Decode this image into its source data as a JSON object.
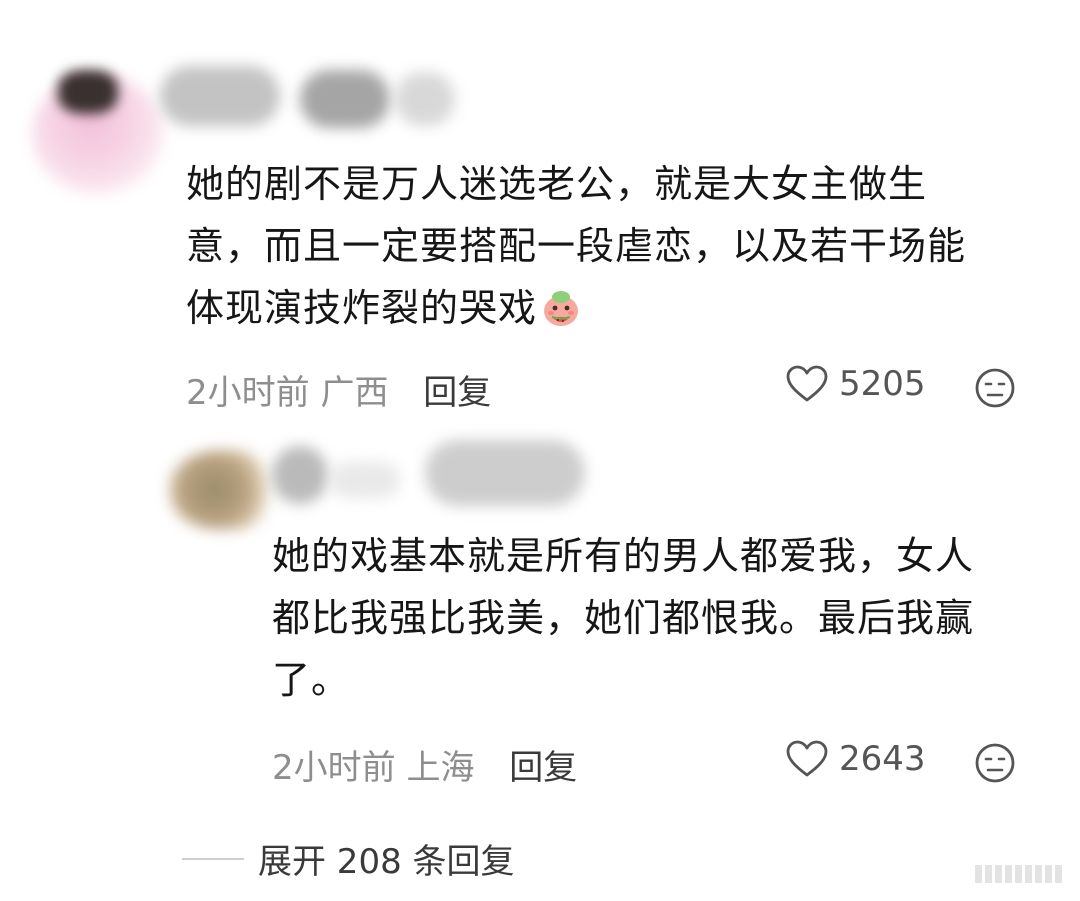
{
  "comment": {
    "text_lines": [
      "她的剧不是万人迷选老公，就是大女主做生",
      "意，而且一定要搭配一段虐恋，以及若干场能",
      "体现演技炸裂的哭戏"
    ],
    "emoji": "watermelon-eating-emoji-icon",
    "time": "2小时前",
    "location": "广西",
    "reply_label": "回复",
    "likes": "5205"
  },
  "reply": {
    "text_lines": [
      "她的戏基本就是所有的男人都爱我，女人",
      "都比我强比我美，她们都恨我。最后我赢",
      "了。"
    ],
    "time": "2小时前",
    "location": "上海",
    "reply_label": "回复",
    "likes": "2643"
  },
  "expand_label": "展开 208 条回复",
  "icons": {
    "like": "heart-outline-icon",
    "dislike": "meh-face-icon"
  },
  "colors": {
    "text": "#161616",
    "meta": "#8e8e8e",
    "action": "#3a3a3a"
  }
}
